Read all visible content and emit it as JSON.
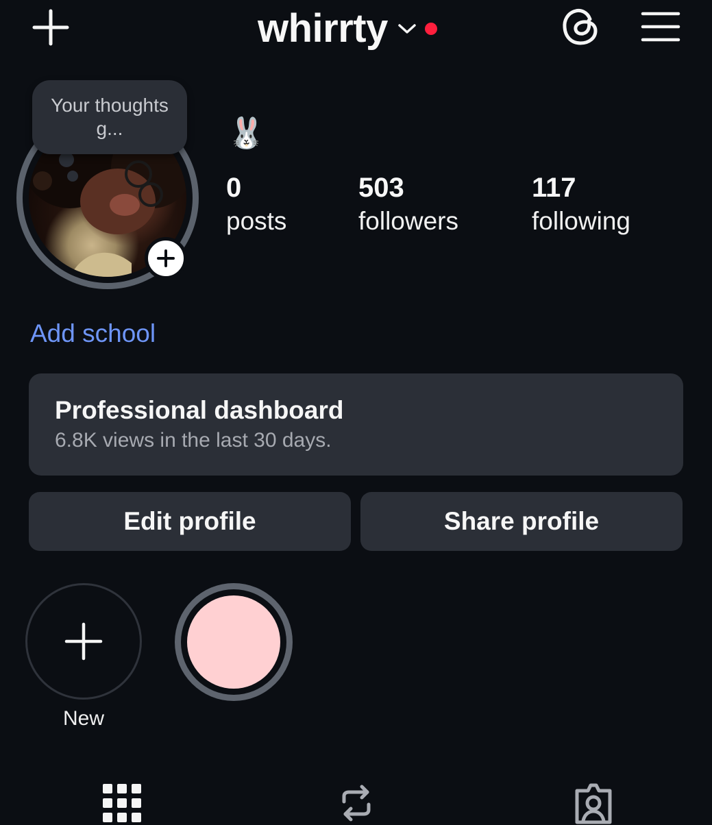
{
  "header": {
    "username": "whirrty",
    "has_notification_dot": true,
    "icons": [
      "plus-icon",
      "chevron-down-icon",
      "threads-icon",
      "menu-icon"
    ]
  },
  "profile": {
    "note_bubble": "Your thoughts g...",
    "note_emoji": "🐰",
    "stats": [
      {
        "value": "0",
        "label": "posts"
      },
      {
        "value": "503",
        "label": "followers"
      },
      {
        "value": "117",
        "label": "following"
      }
    ],
    "add_school": "Add school"
  },
  "dashboard": {
    "title": "Professional dashboard",
    "subtitle": "6.8K views in the last 30 days."
  },
  "buttons": {
    "edit": "Edit profile",
    "share": "Share profile"
  },
  "highlights": {
    "new_label": "New",
    "pink_color": "#ffd0d2"
  },
  "tabs": [
    "grid-icon",
    "reels-repost-icon",
    "tagged-icon"
  ],
  "colors": {
    "background": "#0b0e13",
    "card": "#2b2f37",
    "link": "#6e95f7",
    "notification": "#ff1f3d"
  }
}
